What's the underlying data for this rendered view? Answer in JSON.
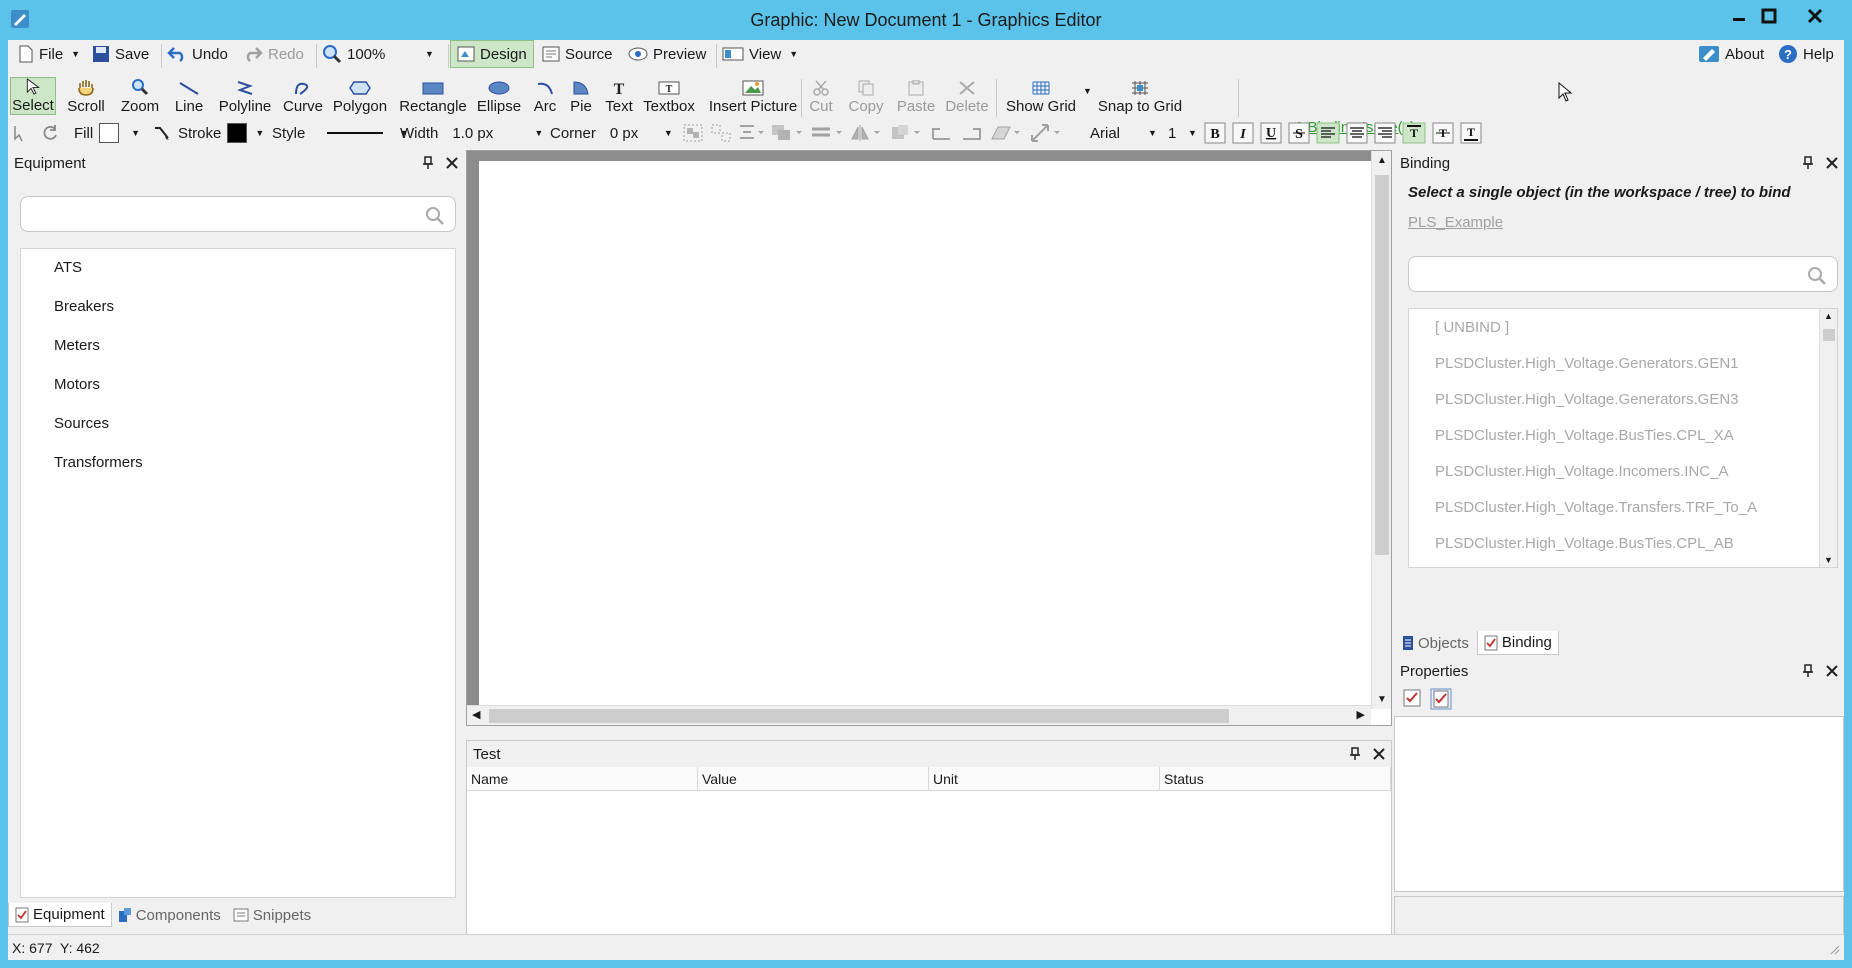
{
  "window": {
    "title": "Graphic: New Document 1 - Graphics Editor"
  },
  "menu": {
    "file": "File",
    "save": "Save",
    "undo": "Undo",
    "redo": "Redo",
    "zoom_value": "100%",
    "design": "Design",
    "source": "Source",
    "preview": "Preview",
    "view": "View",
    "about": "About",
    "help": "Help"
  },
  "tools": {
    "select": "Select",
    "scroll": "Scroll",
    "zoom": "Zoom",
    "line": "Line",
    "polyline": "Polyline",
    "curve": "Curve",
    "polygon": "Polygon",
    "rectangle": "Rectangle",
    "ellipse": "Ellipse",
    "arc": "Arc",
    "pie": "Pie",
    "text": "Text",
    "textbox": "Textbox",
    "insert_picture": "Insert Picture",
    "cut": "Cut",
    "copy": "Copy",
    "paste": "Paste",
    "delete": "Delete",
    "show_grid": "Show Grid",
    "snap_to_grid": "Snap to Grid",
    "binding_issues": "0 Binding Issue(s)"
  },
  "format": {
    "fill": "Fill",
    "stroke": "Stroke",
    "style": "Style",
    "width": "Width",
    "width_value": "1.0 px",
    "corner": "Corner",
    "corner_value": "0 px",
    "font": "Arial",
    "font_size": "1",
    "fill_color": "#ffffff",
    "stroke_color": "#000000"
  },
  "equipment": {
    "title": "Equipment",
    "search_placeholder": "",
    "items": [
      "ATS",
      "Breakers",
      "Meters",
      "Motors",
      "Sources",
      "Transformers"
    ],
    "tabs": [
      "Equipment",
      "Components",
      "Snippets"
    ]
  },
  "test": {
    "title": "Test",
    "columns": [
      "Name",
      "Value",
      "Unit",
      "Status"
    ]
  },
  "binding": {
    "title": "Binding",
    "message": "Select a single object (in the workspace / tree) to bind",
    "link": "PLS_Example",
    "items": [
      "[ UNBIND ]",
      "PLSDCluster.High_Voltage.Generators.GEN1",
      "PLSDCluster.High_Voltage.Generators.GEN3",
      "PLSDCluster.High_Voltage.BusTies.CPL_XA",
      "PLSDCluster.High_Voltage.Incomers.INC_A",
      "PLSDCluster.High_Voltage.Transfers.TRF_To_A",
      "PLSDCluster.High_Voltage.BusTies.CPL_AB"
    ],
    "tabs": [
      "Objects",
      "Binding"
    ]
  },
  "properties": {
    "title": "Properties"
  },
  "status": {
    "coords": "X: 677  Y: 462"
  },
  "colors": {
    "titlebar": "#5bc3ea",
    "active_tool": "#cde6c7",
    "link_green": "#2e9a2e"
  }
}
